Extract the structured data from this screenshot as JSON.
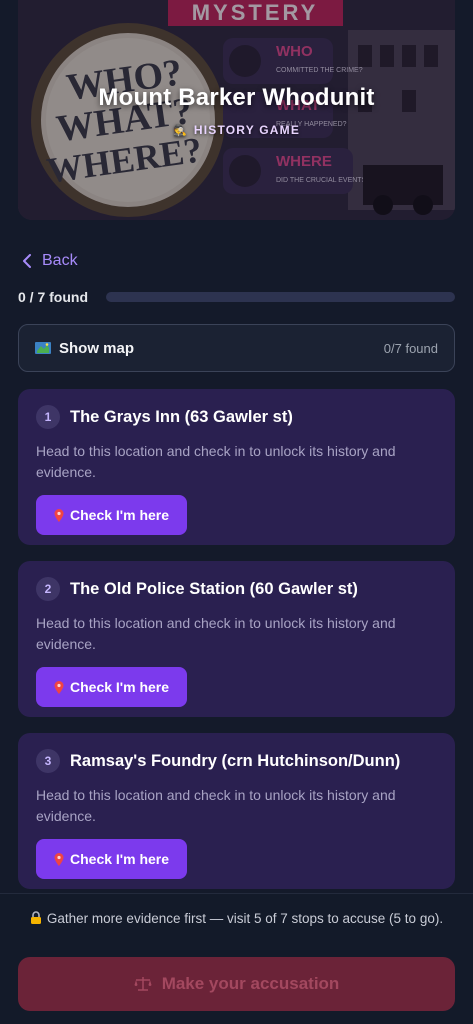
{
  "hero": {
    "title": "Mount Barker Whodunit",
    "subtitle": "HISTORY GAME",
    "subtitle_icon": "detective-emoji",
    "art_texts": {
      "banner": "MYSTERY",
      "big_line_1": "WHO?",
      "big_line_2": "WHAT?",
      "big_line_3": "WHERE?",
      "q1_head": "WHO",
      "q1_text": "COMMITTED THE CRIME?",
      "q2_head": "WHAT",
      "q2_text": "REALLY HAPPENED?",
      "q3_head": "WHERE",
      "q3_text": "DID THE CRUCIAL EVENTS UNFOLD?"
    }
  },
  "nav": {
    "back_label": "Back"
  },
  "progress": {
    "label": "0 / 7 found",
    "found": 0,
    "total": 7
  },
  "map": {
    "label": "Show map",
    "count": "0/7 found",
    "icon": "map-icon"
  },
  "stops": [
    {
      "number": "1",
      "title": "The Grays Inn (63 Gawler st)",
      "description": "Head to this location and check in to unlock its history and evidence.",
      "button_label": "Check I'm here"
    },
    {
      "number": "2",
      "title": "The Old Police Station (60 Gawler st)",
      "description": "Head to this location and check in to unlock its history and evidence.",
      "button_label": "Check I'm here"
    },
    {
      "number": "3",
      "title": "Ramsay's Foundry (crn Hutchinson/Dunn)",
      "description": "Head to this location and check in to unlock its history and evidence.",
      "button_label": "Check I'm here"
    }
  ],
  "footer": {
    "gate_text": "Gather more evidence first — visit 5 of 7 stops to accuse (5 to go).",
    "accuse_label": "Make your accusation"
  },
  "colors": {
    "accent": "#7c3aed",
    "accent_text": "#a78bfa",
    "card_bg": "#2a2050",
    "accuse_disabled": "#6b2338",
    "page_bg": "#141a2a"
  }
}
